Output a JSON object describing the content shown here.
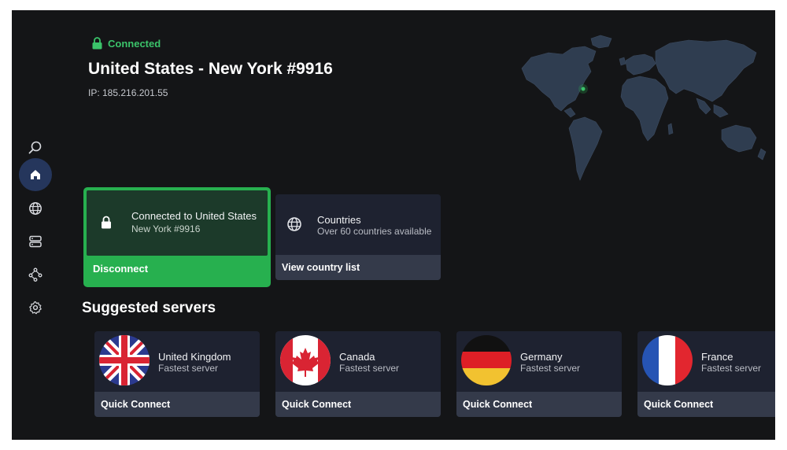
{
  "status": {
    "label": "Connected",
    "color": "#3bc36a"
  },
  "connection": {
    "server_name": "United States - New York #9916",
    "ip": "IP: 185.216.201.55"
  },
  "sidebar": {
    "items": [
      {
        "id": "search",
        "icon": "search-icon",
        "active": false
      },
      {
        "id": "home",
        "icon": "home-icon",
        "active": true
      },
      {
        "id": "countries",
        "icon": "globe-icon",
        "active": false
      },
      {
        "id": "servers",
        "icon": "server-icon",
        "active": false
      },
      {
        "id": "specialty",
        "icon": "network-icon",
        "active": false
      },
      {
        "id": "settings",
        "icon": "gear-icon",
        "active": false
      }
    ]
  },
  "connected_card": {
    "title": "Connected to United States",
    "subtitle": "New York #9916",
    "action": "Disconnect"
  },
  "countries_card": {
    "title": "Countries",
    "subtitle": "Over 60 countries available",
    "action": "View country list"
  },
  "suggested": {
    "title": "Suggested servers",
    "servers": [
      {
        "country": "United Kingdom",
        "subtitle": "Fastest server",
        "action": "Quick Connect",
        "flag": "uk-flag-icon"
      },
      {
        "country": "Canada",
        "subtitle": "Fastest server",
        "action": "Quick Connect",
        "flag": "canada-flag-icon"
      },
      {
        "country": "Germany",
        "subtitle": "Fastest server",
        "action": "Quick Connect",
        "flag": "germany-flag-icon"
      },
      {
        "country": "France",
        "subtitle": "Fastest server",
        "action": "Quick Connect",
        "flag": "france-flag-icon"
      }
    ]
  },
  "colors": {
    "accent": "#27b04f",
    "background": "#141517",
    "card": "#1e2230",
    "nav_active": "#25365c",
    "map": "#2f3d50"
  }
}
